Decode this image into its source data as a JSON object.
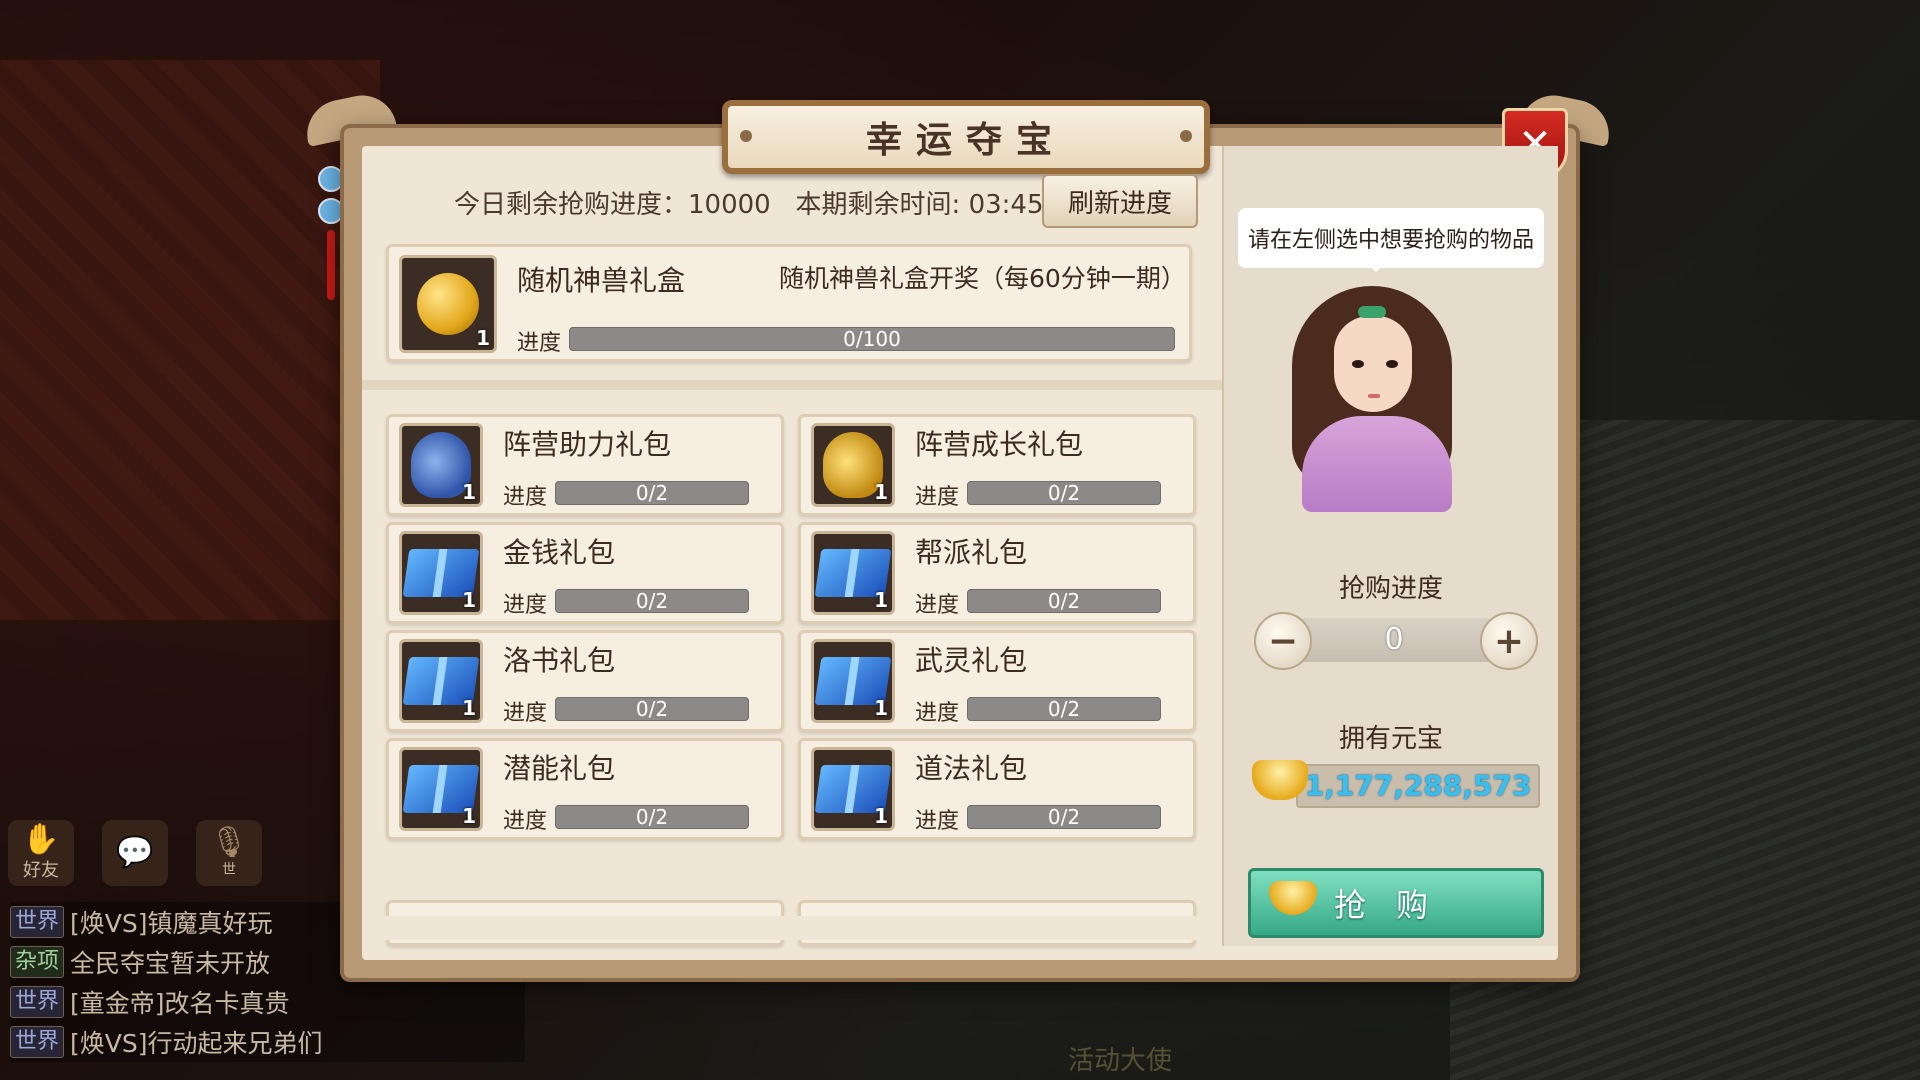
{
  "window": {
    "title": "幸运夺宝",
    "close_icon": "close-icon"
  },
  "status": {
    "remaining_label": "今日剩余抢购进度：",
    "remaining_value": "10000",
    "time_label": "本期剩余时间: ",
    "time_value": "03:45",
    "refresh_label": "刷新进度"
  },
  "featured": {
    "name": "随机神兽礼盒",
    "description": "随机神兽礼盒开奖（每60分钟一期）",
    "progress_label": "进度",
    "progress_text": "0/100",
    "progress": 0,
    "qty": "1",
    "icon": "bell-icon"
  },
  "items": [
    {
      "name": "阵营助力礼包",
      "progress_label": "进度",
      "progress_text": "0/2",
      "progress": 0,
      "qty": "1",
      "icon": "blue-bag-icon"
    },
    {
      "name": "阵营成长礼包",
      "progress_label": "进度",
      "progress_text": "0/2",
      "progress": 0,
      "qty": "1",
      "icon": "gold-bag-icon"
    },
    {
      "name": "金钱礼包",
      "progress_label": "进度",
      "progress_text": "0/2",
      "progress": 0,
      "qty": "1",
      "icon": "gift-box-icon"
    },
    {
      "name": "帮派礼包",
      "progress_label": "进度",
      "progress_text": "0/2",
      "progress": 0,
      "qty": "1",
      "icon": "gift-box-icon"
    },
    {
      "name": "洛书礼包",
      "progress_label": "进度",
      "progress_text": "0/2",
      "progress": 0,
      "qty": "1",
      "icon": "gift-box-icon"
    },
    {
      "name": "武灵礼包",
      "progress_label": "进度",
      "progress_text": "0/2",
      "progress": 0,
      "qty": "1",
      "icon": "gift-box-icon"
    },
    {
      "name": "潜能礼包",
      "progress_label": "进度",
      "progress_text": "0/2",
      "progress": 0,
      "qty": "1",
      "icon": "gift-box-icon"
    },
    {
      "name": "道法礼包",
      "progress_label": "进度",
      "progress_text": "0/2",
      "progress": 0,
      "qty": "1",
      "icon": "gift-box-icon"
    }
  ],
  "side": {
    "hint": "请在左侧选中想要抢购的物品",
    "buy_progress_label": "抢购进度",
    "quantity": "0",
    "yuanbao_label": "拥有元宝",
    "yuanbao_value": "1,177,288,573",
    "buy_label": "抢购"
  },
  "hud": {
    "friends_label": "好友",
    "chat_icon": "chat-icon",
    "mic_icon": "microphone-icon",
    "mic_badge": "世"
  },
  "chat": [
    {
      "tag": "世界",
      "kind": "world",
      "text": "[焕VS]镇魔真好玩"
    },
    {
      "tag": "杂项",
      "kind": "misc",
      "text": "全民夺宝暂未开放"
    },
    {
      "tag": "世界",
      "kind": "world",
      "text": "[童金帝]改名卡真贵"
    },
    {
      "tag": "世界",
      "kind": "world",
      "text": "[焕VS]行动起来兄弟们"
    }
  ],
  "bottom_npc_label": "活动大使",
  "colors": {
    "accent_green": "#36a886",
    "close_red": "#c81e18",
    "yuanbao_blue": "#36c0f0"
  }
}
